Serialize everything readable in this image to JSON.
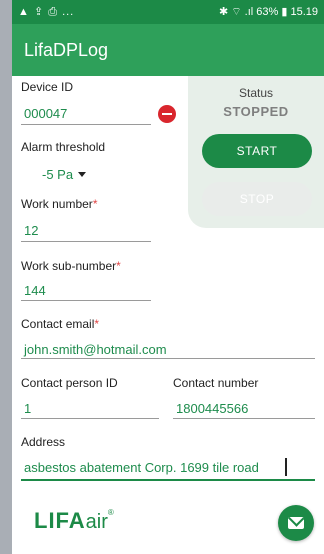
{
  "statusbar": {
    "left_icons": "▲ ⇪ ⎙ ...",
    "right": "✱ ⌔ .ıl 63% ▮ 15.19"
  },
  "app": {
    "title": "LifaDPLog"
  },
  "status_panel": {
    "label": "Status",
    "value": "STOPPED",
    "start_label": "START",
    "stop_label": "STOP"
  },
  "form": {
    "device_id": {
      "label": "Device ID",
      "value": "000047"
    },
    "alarm_threshold": {
      "label": "Alarm threshold",
      "value": "-5 Pa"
    },
    "work_number": {
      "label": "Work number",
      "required": "*",
      "value": "12"
    },
    "work_sub_number": {
      "label": "Work sub-number",
      "required": "*",
      "value": "144"
    },
    "contact_email": {
      "label": "Contact email",
      "required": "*",
      "value": "john.smith@hotmail.com"
    },
    "contact_person_id": {
      "label": "Contact person ID",
      "value": "1"
    },
    "contact_number": {
      "label": "Contact number",
      "value": "1800445566"
    },
    "address": {
      "label": "Address",
      "value": "asbestos abatement Corp. 1699 tile road"
    }
  },
  "footer": {
    "logo_main": "LIFA",
    "logo_sub": "air",
    "logo_mark": "®"
  },
  "colors": {
    "primary": "#2ea05a",
    "dark": "#1c8a47",
    "danger": "#d9262d",
    "panel": "#e7efe9"
  }
}
